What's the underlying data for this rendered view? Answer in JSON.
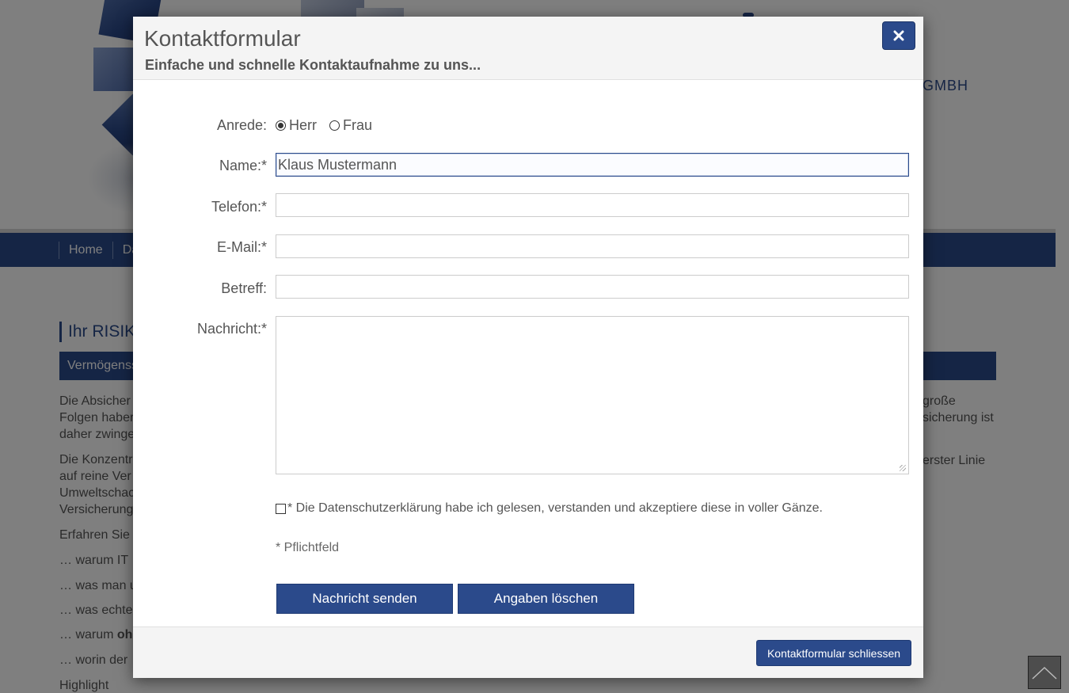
{
  "background": {
    "brand_tail": "GMBH",
    "nav": [
      "Home",
      "Da"
    ],
    "title": "Ihr RISIKO",
    "section": "Vermögenss",
    "para1_left": "Die Absicher",
    "para1_left2": "Folgen haber",
    "para1_left3": "daher zwinge",
    "para1_right": "große",
    "para1_right2": "sicherung ist",
    "para2_left": "Die Konzentr",
    "para2_left2": "auf reine Ver",
    "para2_left3": "Umweltschac",
    "para2_left4": "Versicherung",
    "para2_right": "erster Linie",
    "line_erfahren": "Erfahren Sie",
    "bullet1": "… warum IT",
    "bullet2": "… was man u",
    "bullet3": "… was echte",
    "bullet4_pre": "… warum ",
    "bullet4_bold": "oh",
    "bullet5": "… worin der",
    "highlight": "Highlight"
  },
  "modal": {
    "title": "Kontaktformular",
    "subtitle": "Einfache und schnelle Kontaktaufnahme zu uns...",
    "close_icon": "close-icon"
  },
  "form": {
    "salutation": {
      "label": "Anrede:",
      "options": [
        {
          "label": "Herr",
          "checked": true
        },
        {
          "label": "Frau",
          "checked": false
        }
      ]
    },
    "name": {
      "label": "Name:*",
      "value": "Klaus Mustermann"
    },
    "phone": {
      "label": "Telefon:*",
      "value": ""
    },
    "email": {
      "label": "E-Mail:*",
      "value": ""
    },
    "subject": {
      "label": "Betreff:",
      "value": ""
    },
    "message": {
      "label": "Nachricht:*",
      "value": ""
    },
    "consent": "* Die Datenschutzerklärung habe ich gelesen, verstanden und akzeptiere diese in voller Gänze.",
    "required_note": "* Pflichtfeld",
    "send_label": "Nachricht senden",
    "reset_label": "Angaben löschen"
  },
  "footer": {
    "close_label": "Kontaktformular schliessen"
  },
  "colors": {
    "brand": "#2b4a8b",
    "overlay": "rgba(0,0,0,0.5)"
  }
}
